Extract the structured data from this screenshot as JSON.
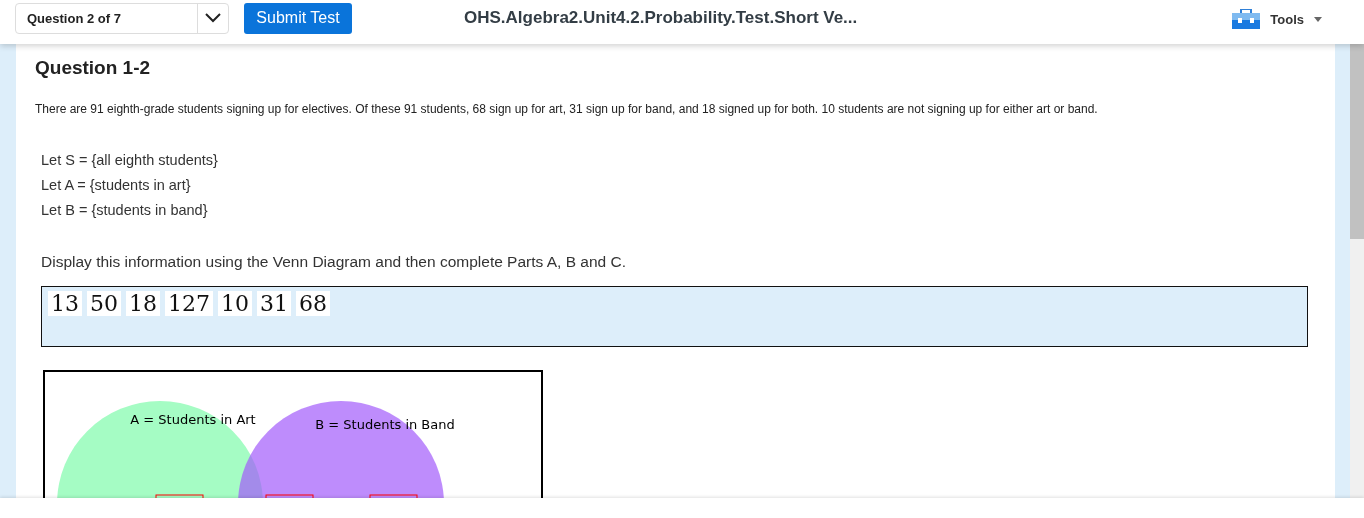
{
  "header": {
    "question_select": "Question 2 of 7",
    "submit_button": "Submit Test",
    "title": "OHS.Algebra2.Unit4.2.Probability.Test.Short Ve...",
    "tools": "Tools"
  },
  "question": {
    "heading": "Question 1-2",
    "prompt": "There are 91 eighth-grade students signing up for electives. Of these 91 students, 68 sign up for art, 31 sign up for band, and 18 signed up for both. 10 students are not signing up for either art or band.",
    "definitions": [
      "Let S = {all eighth students}",
      "Let A = {students in art}",
      "Let B = {students in band}"
    ],
    "instruction": "Display this information using the Venn Diagram and then complete Parts A, B and C.",
    "tiles": [
      "13",
      "50",
      "18",
      "127",
      "10",
      "31",
      "68"
    ],
    "venn": {
      "label_a": "A = Students in Art",
      "label_b": "B = Students in Band"
    }
  }
}
